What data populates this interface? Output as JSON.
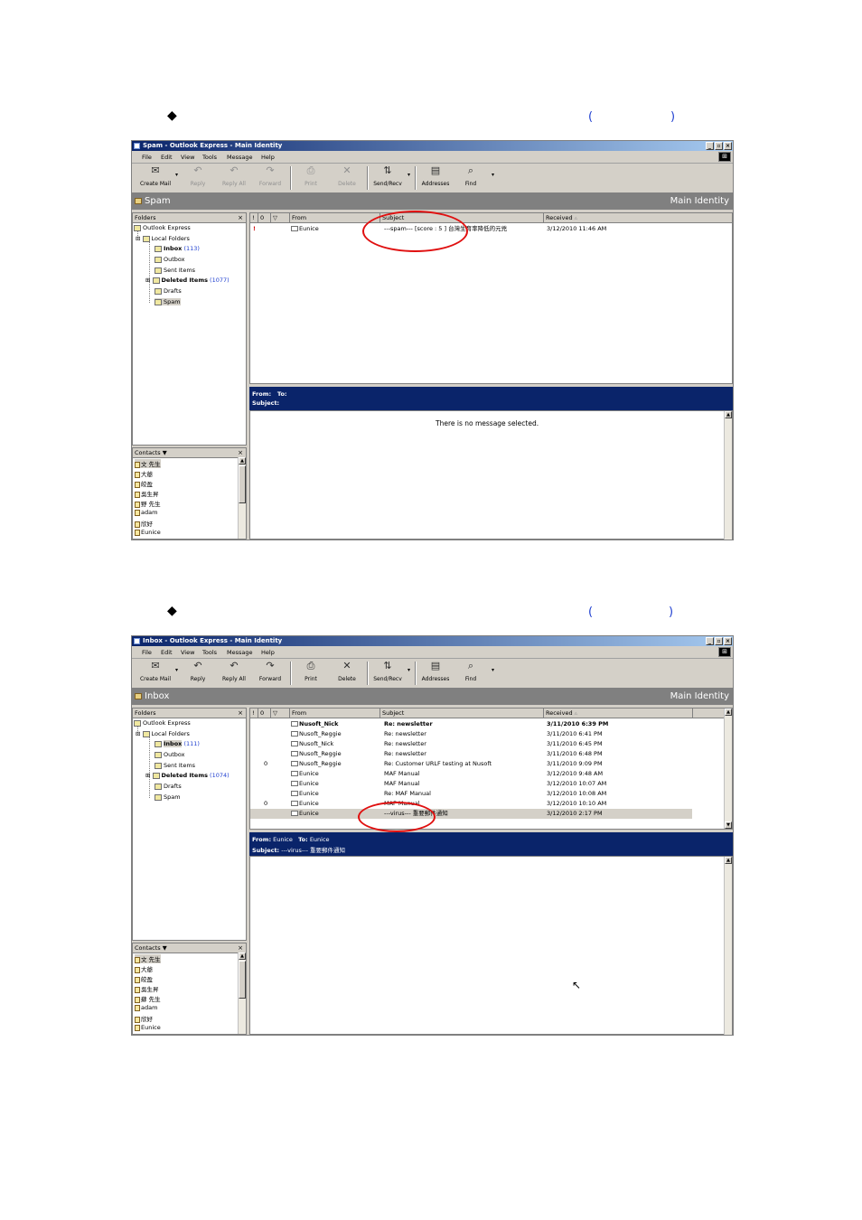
{
  "section1": {
    "parens": [
      "(",
      ")"
    ],
    "window": {
      "title": "Spam - Outlook Express - Main Identity",
      "menu": [
        "File",
        "Edit",
        "View",
        "Tools",
        "Message",
        "Help"
      ],
      "toolbar": [
        {
          "label": "Create Mail",
          "icon": "create-mail-icon",
          "enabled": true
        },
        {
          "label": "Reply",
          "icon": "reply-icon",
          "enabled": false
        },
        {
          "label": "Reply All",
          "icon": "reply-all-icon",
          "enabled": false
        },
        {
          "label": "Forward",
          "icon": "forward-icon",
          "enabled": false
        },
        {
          "label": "Print",
          "icon": "print-icon",
          "enabled": false
        },
        {
          "label": "Delete",
          "icon": "delete-icon",
          "enabled": false
        },
        {
          "label": "Send/Recv",
          "icon": "send-recv-icon",
          "enabled": true
        },
        {
          "label": "Addresses",
          "icon": "addresses-icon",
          "enabled": true
        },
        {
          "label": "Find",
          "icon": "find-icon",
          "enabled": true
        }
      ],
      "banner_left": "Spam",
      "banner_right": "Main Identity",
      "folders_header": "Folders",
      "folders": {
        "root": "Outlook Express",
        "local": "Local Folders",
        "inbox": "Inbox",
        "inbox_count": "(113)",
        "outbox": "Outbox",
        "sent": "Sent Items",
        "deleted": "Deleted Items",
        "deleted_count": "(1077)",
        "drafts": "Drafts",
        "spam": "Spam"
      },
      "columns": [
        "!",
        "0",
        "▽",
        "From",
        "Subject",
        "Received"
      ],
      "messages": [
        {
          "priority": "!",
          "from": "Eunice",
          "subject": "---spam---  [score : 5 ]   台灣生育率降低的元兇",
          "received": "3/12/2010 11:46 AM"
        }
      ],
      "preview_from_label": "From:",
      "preview_to_label": "To:",
      "preview_subject_label": "Subject:",
      "preview_empty": "There is no message selected.",
      "contacts_header": "Contacts ▼",
      "contacts": [
        "文 先生",
        "大爺",
        "皎盈",
        "吳生昇",
        "野 先生",
        "adam",
        "欣好",
        "Eunice"
      ]
    }
  },
  "section2": {
    "parens": [
      "(",
      ")"
    ],
    "window": {
      "title": "Inbox - Outlook Express - Main Identity",
      "menu": [
        "File",
        "Edit",
        "View",
        "Tools",
        "Message",
        "Help"
      ],
      "toolbar": [
        {
          "label": "Create Mail",
          "icon": "create-mail-icon",
          "enabled": true
        },
        {
          "label": "Reply",
          "icon": "reply-icon",
          "enabled": true
        },
        {
          "label": "Reply All",
          "icon": "reply-all-icon",
          "enabled": true
        },
        {
          "label": "Forward",
          "icon": "forward-icon",
          "enabled": true
        },
        {
          "label": "Print",
          "icon": "print-icon",
          "enabled": true
        },
        {
          "label": "Delete",
          "icon": "delete-icon",
          "enabled": true
        },
        {
          "label": "Send/Recv",
          "icon": "send-recv-icon",
          "enabled": true
        },
        {
          "label": "Addresses",
          "icon": "addresses-icon",
          "enabled": true
        },
        {
          "label": "Find",
          "icon": "find-icon",
          "enabled": true
        }
      ],
      "banner_left": "Inbox",
      "banner_right": "Main Identity",
      "folders_header": "Folders",
      "folders": {
        "root": "Outlook Express",
        "local": "Local Folders",
        "inbox": "Inbox",
        "inbox_count": "(111)",
        "outbox": "Outbox",
        "sent": "Sent Items",
        "deleted": "Deleted Items",
        "deleted_count": "(1074)",
        "drafts": "Drafts",
        "spam": "Spam"
      },
      "columns": [
        "!",
        "0",
        "▽",
        "From",
        "Subject",
        "Received"
      ],
      "messages": [
        {
          "attach": "",
          "from": "Nusoft_Nick",
          "subject": "Re: newsletter",
          "received": "3/11/2010 6:39 PM",
          "bold": true
        },
        {
          "attach": "",
          "from": "Nusoft_Reggie",
          "subject": "Re: newsletter",
          "received": "3/11/2010 6:41 PM",
          "bold": false
        },
        {
          "attach": "",
          "from": "Nusoft_Nick",
          "subject": "Re: newsletter",
          "received": "3/11/2010 6:45 PM",
          "bold": false
        },
        {
          "attach": "",
          "from": "Nusoft_Reggie",
          "subject": "Re: newsletter",
          "received": "3/11/2010 6:48 PM",
          "bold": false
        },
        {
          "attach": "0",
          "from": "Nusoft_Reggie",
          "subject": "Re: Customer URLF testing at Nusoft",
          "received": "3/11/2010 9:09 PM",
          "bold": false
        },
        {
          "attach": "",
          "from": "Eunice",
          "subject": "MAF Manual",
          "received": "3/12/2010 9:48 AM",
          "bold": false
        },
        {
          "attach": "",
          "from": "Eunice",
          "subject": "MAF Manual",
          "received": "3/12/2010 10:07 AM",
          "bold": false
        },
        {
          "attach": "",
          "from": "Eunice",
          "subject": "Re: MAF Manual",
          "received": "3/12/2010 10:08 AM",
          "bold": false
        },
        {
          "attach": "0",
          "from": "Eunice",
          "subject": "MAF Manual",
          "received": "3/12/2010 10:10 AM",
          "bold": false
        },
        {
          "attach": "",
          "from": "Eunice",
          "subject": "---virus---  重要郵件通知",
          "received": "3/12/2010 2:17 PM",
          "bold": false,
          "selected": true
        }
      ],
      "preview_from_label": "From:",
      "preview_from": "Eunice",
      "preview_to_label": "To:",
      "preview_to": "Eunice",
      "preview_subject_label": "Subject:",
      "preview_subject": "---virus---  重要郵件通知",
      "contacts_header": "Contacts ▼",
      "contacts": [
        "文 先生",
        "大爺",
        "皎盈",
        "吳生昇",
        "蘇 先生",
        "adam",
        "欣好",
        "Eunice"
      ]
    }
  }
}
